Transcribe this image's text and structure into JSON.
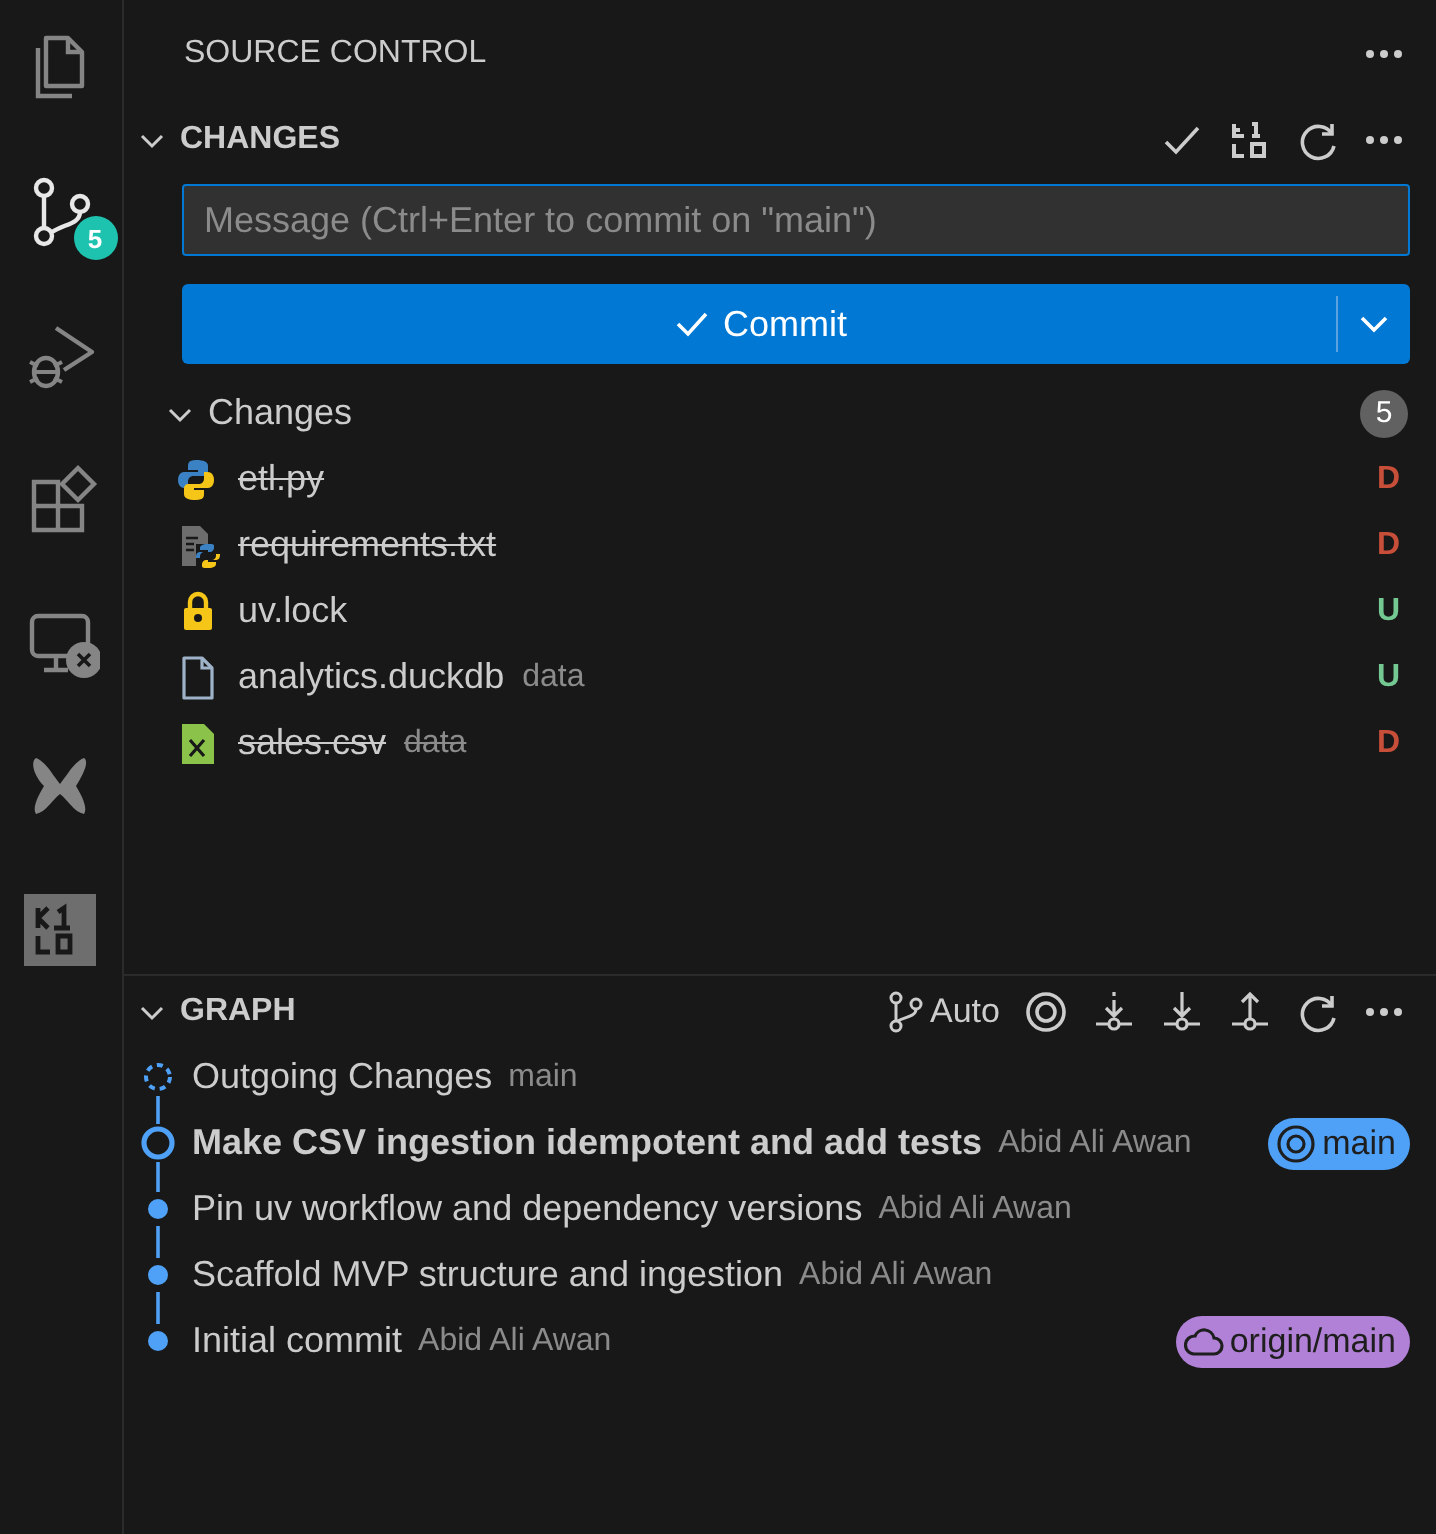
{
  "activity_bar": [
    {
      "kind": "explorer",
      "selected": false
    },
    {
      "kind": "source-control",
      "selected": true,
      "badge": "5"
    },
    {
      "kind": "run-debug",
      "selected": false
    },
    {
      "kind": "extensions",
      "selected": false
    },
    {
      "kind": "remote",
      "selected": false
    },
    {
      "kind": "butterfly",
      "selected": false
    },
    {
      "kind": "kilo",
      "selected": false
    }
  ],
  "sidebar": {
    "title": "SOURCE CONTROL"
  },
  "changes": {
    "title": "CHANGES",
    "expanded": true,
    "message": {
      "placeholder": "Message (Ctrl+Enter to commit on \"main\")"
    },
    "commit_button": "Commit",
    "group": {
      "label": "Changes",
      "expanded": true,
      "count": "5",
      "files": [
        {
          "kind": "python",
          "name": "etl.py",
          "status": "D",
          "deleted": true,
          "color": "#c74e39"
        },
        {
          "kind": "python-doc",
          "name": "requirements.txt",
          "status": "D",
          "deleted": true,
          "color": "#c74e39"
        },
        {
          "kind": "lock",
          "name": "uv.lock",
          "status": "U",
          "deleted": false,
          "color": "#73c991"
        },
        {
          "kind": "file",
          "name": "analytics.duckdb",
          "description": "data",
          "status": "U",
          "deleted": false,
          "color": "#73c991"
        },
        {
          "kind": "csv",
          "name": "sales.csv",
          "description": "data",
          "status": "D",
          "deleted": true,
          "color": "#c74e39"
        }
      ]
    }
  },
  "graph": {
    "title": "GRAPH",
    "expanded": true,
    "mode": "Auto",
    "commits": [
      {
        "kind": "outgoing",
        "message": "Outgoing Changes",
        "description": "main",
        "bold": false
      },
      {
        "kind": "head",
        "message": "Make CSV ingestion idempotent and add tests",
        "description": "Abid Ali Awan",
        "bold": true,
        "ref": {
          "kind": "local",
          "label": "main",
          "color": "#4fa1f7"
        }
      },
      {
        "kind": "commit",
        "message": "Pin uv workflow and dependency versions",
        "description": "Abid Ali Awan",
        "bold": false
      },
      {
        "kind": "commit",
        "message": "Scaffold MVP structure and ingestion",
        "description": "Abid Ali Awan",
        "bold": false
      },
      {
        "kind": "commit",
        "message": "Initial commit",
        "description": "Abid Ali Awan",
        "bold": false,
        "ref": {
          "kind": "remote",
          "label": "origin/main",
          "color": "#b180d7"
        }
      }
    ]
  }
}
